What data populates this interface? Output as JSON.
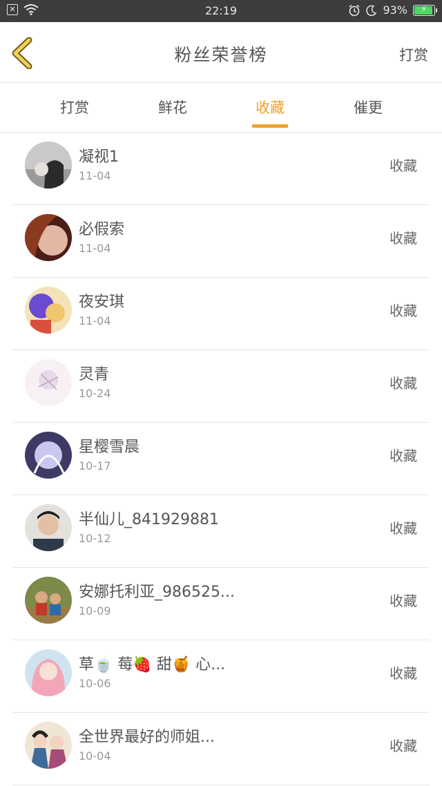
{
  "status_bar": {
    "time": "22:19",
    "battery": "93%",
    "battery_level": 0.93,
    "sim_glyph": "✕"
  },
  "header": {
    "title": "粉丝荣誉榜",
    "action": "打赏"
  },
  "tabs": [
    {
      "label": "打赏",
      "active": false
    },
    {
      "label": "鲜花",
      "active": false
    },
    {
      "label": "收藏",
      "active": true
    },
    {
      "label": "催更",
      "active": false
    }
  ],
  "accent_color": "#f0a12a",
  "fans": [
    {
      "name": "凝视1",
      "date": "11-04",
      "tag": "收藏"
    },
    {
      "name": "必假索",
      "date": "11-04",
      "tag": "收藏"
    },
    {
      "name": "夜安琪",
      "date": "11-04",
      "tag": "收藏"
    },
    {
      "name": "灵青",
      "date": "10-24",
      "tag": "收藏"
    },
    {
      "name": "星樱雪晨",
      "date": "10-17",
      "tag": "收藏"
    },
    {
      "name": "半仙儿_841929881",
      "date": "10-12",
      "tag": "收藏"
    },
    {
      "name": "安娜托利亚_986525...",
      "date": "10-09",
      "tag": "收藏"
    },
    {
      "name": "草🍵 莓🍓 甜🍯 心...",
      "date": "10-06",
      "tag": "收藏"
    },
    {
      "name": "全世界最好的师姐...",
      "date": "10-04",
      "tag": "收藏"
    }
  ]
}
